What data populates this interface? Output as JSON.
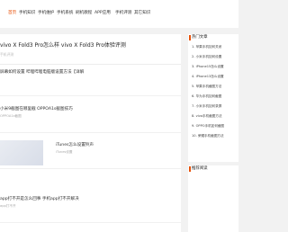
{
  "nav": {
    "items": [
      {
        "label": "首页",
        "active": true
      },
      {
        "label": "手机知识",
        "active": false
      },
      {
        "label": "手机维护",
        "active": false
      },
      {
        "label": "手机系统",
        "active": false
      },
      {
        "label": "刷机教程",
        "active": false
      },
      {
        "label": "APP应用",
        "active": false
      },
      {
        "label": "手机评测",
        "active": false
      },
      {
        "label": "其它知识",
        "active": false
      }
    ]
  },
  "article": {
    "title": "vivo X Fold3 Pro怎么样 vivo X Fold3 Pro体验评测",
    "meta": "手机评测"
  },
  "posts": [
    {
      "title": "屏幕如何设置 哔哩哔哩电脑版设置方法【详解",
      "meta": "",
      "thumb": false
    },
    {
      "title": "小米9截图在哪里截 OPPOA1s截图技巧",
      "meta": "OPPOA1s截图",
      "thumb": false
    },
    {
      "title": "iTunes怎么设置铃声",
      "meta": "iTunes设置",
      "thumb": true
    },
    {
      "title": "app打不开是怎么回事 手机app打不开解决",
      "meta": "app打不开",
      "thumb": false
    }
  ],
  "sidebar": {
    "box1_title": "热门文章",
    "items": [
      "1. 苹果手机如何关闭",
      "2. 小米手机如何设置",
      "3. iPhone15怎么设置",
      "4. iPhone13怎么设置",
      "5. 苹果手机截图方法",
      "6. 华为手机如何截图",
      "7. 小米手机如何录屏",
      "8. vivo手机截图方法",
      "9. OPPO手机如何截图",
      "10. 荣耀手机截图方法"
    ],
    "box2_title": "推荐阅读"
  }
}
